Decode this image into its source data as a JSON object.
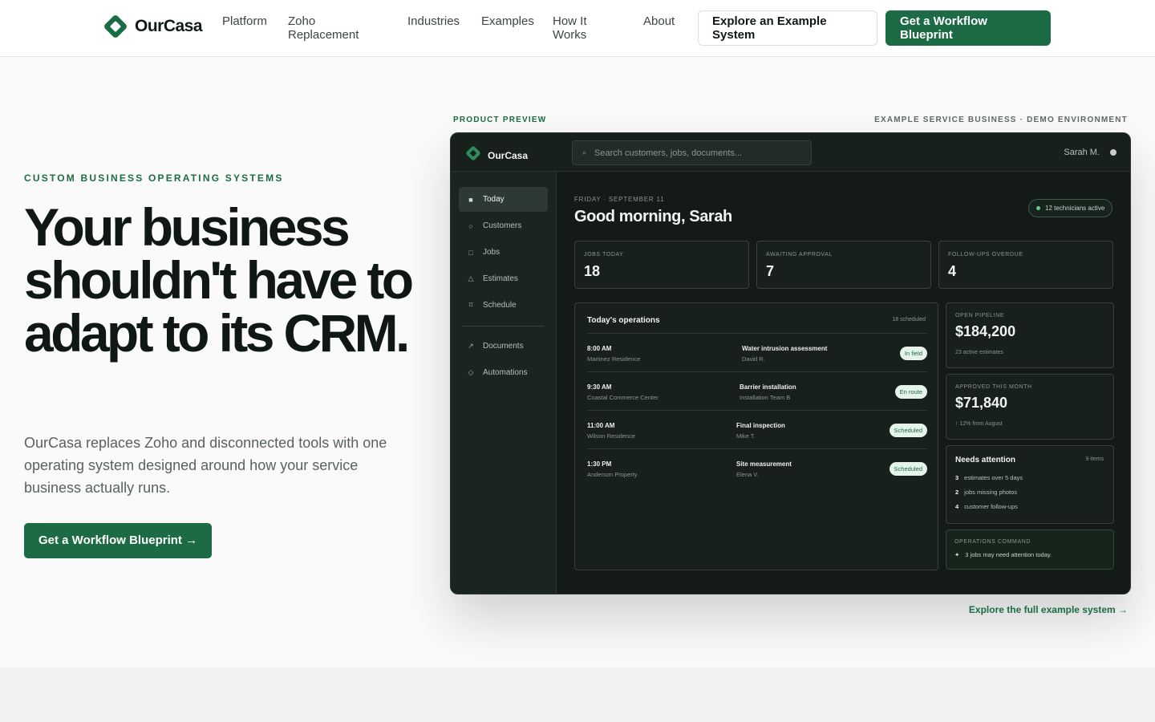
{
  "nav": {
    "brand": "OurCasa",
    "links": [
      "Platform",
      "Zoho Replacement",
      "Industries",
      "Examples",
      "How It Works",
      "About"
    ],
    "explore_button": "Explore an Example System",
    "blueprint_button": "Get a Workflow Blueprint"
  },
  "hero": {
    "eyebrow": "CUSTOM BUSINESS OPERATING SYSTEMS",
    "headline": "Your business shouldn't have to adapt to its CRM.",
    "subcopy": "OurCasa replaces Zoho and disconnected tools with one operating system designed around how your service business actually runs.",
    "cta": "Get a Workflow Blueprint →"
  },
  "preview": {
    "label_left": "PRODUCT PREVIEW",
    "label_right": "EXAMPLE SERVICE BUSINESS · DEMO ENVIRONMENT",
    "explore_link": "Explore the full example system →"
  },
  "app": {
    "brand": "OurCasa",
    "search_placeholder": "Search customers, jobs, documents...",
    "user_name": "Sarah M.",
    "sidebar": [
      {
        "label": "Today",
        "icon": "square-icon",
        "glyph": "■",
        "active": true
      },
      {
        "label": "Customers",
        "icon": "circle-icon",
        "glyph": "○",
        "active": false
      },
      {
        "label": "Jobs",
        "icon": "box-icon",
        "glyph": "□",
        "active": false
      },
      {
        "label": "Estimates",
        "icon": "triangle-icon",
        "glyph": "△",
        "active": false
      },
      {
        "label": "Schedule",
        "icon": "calendar-icon",
        "glyph": "⌑",
        "active": false
      },
      {
        "label": "Documents",
        "icon": "arrow-upright-icon",
        "glyph": "↗",
        "active": false
      },
      {
        "label": "Automations",
        "icon": "diamond-icon",
        "glyph": "◇",
        "active": false
      }
    ],
    "date": "FRIDAY · SEPTEMBER 11",
    "greeting": "Good morning, Sarah",
    "technicians_badge": "12 technicians active",
    "stats": [
      {
        "label": "JOBS TODAY",
        "value": "18"
      },
      {
        "label": "AWAITING APPROVAL",
        "value": "7"
      },
      {
        "label": "FOLLOW-UPS OVERDUE",
        "value": "4"
      }
    ],
    "operations": {
      "title": "Today's operations",
      "count": "18 scheduled",
      "rows": [
        {
          "time": "8:00 AM",
          "place": "Martinez Residence",
          "task": "Water intrusion assessment",
          "who": "David R.",
          "status": "In field"
        },
        {
          "time": "9:30 AM",
          "place": "Coastal Commerce Center",
          "task": "Barrier installation",
          "who": "Installation Team B",
          "status": "En route"
        },
        {
          "time": "11:00 AM",
          "place": "Wilson Residence",
          "task": "Final inspection",
          "who": "Mike T.",
          "status": "Scheduled"
        },
        {
          "time": "1:30 PM",
          "place": "Anderson Property",
          "task": "Site measurement",
          "who": "Elena V.",
          "status": "Scheduled"
        }
      ]
    },
    "pipeline": {
      "label": "OPEN PIPELINE",
      "value": "$184,200",
      "sub": "23 active estimates"
    },
    "approved": {
      "label": "APPROVED THIS MONTH",
      "value": "$71,840",
      "sub": "↑ 12% from August"
    },
    "attention": {
      "title": "Needs attention",
      "count": "9 items",
      "items": [
        {
          "num": "3",
          "text": "estimates over 5 days"
        },
        {
          "num": "2",
          "text": "jobs missing photos"
        },
        {
          "num": "4",
          "text": "customer follow-ups"
        }
      ]
    },
    "command": {
      "label": "OPERATIONS COMMAND",
      "spark": "✦",
      "message": "3 jobs may need attention today."
    }
  },
  "colors": {
    "brand_green": "#1d6b45",
    "app_bg": "#18201c",
    "status_pill": "#e6f3ea"
  }
}
